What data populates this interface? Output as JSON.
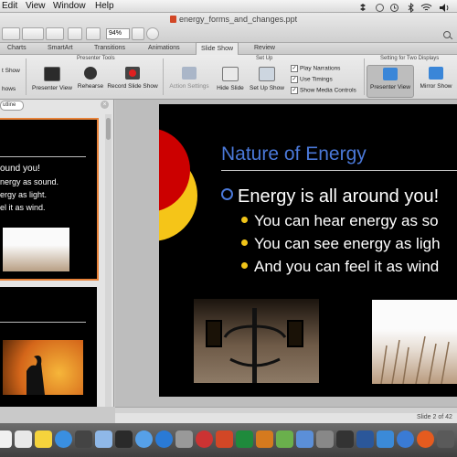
{
  "menu": {
    "items": [
      "Edit",
      "View",
      "Window",
      "Help"
    ]
  },
  "window": {
    "title": "energy_forms_and_changes.ppt",
    "zoom": "94%"
  },
  "ribbon_tabs": [
    "Charts",
    "SmartArt",
    "Transitions",
    "Animations",
    "Slide Show",
    "Review"
  ],
  "ribbon": {
    "groups": {
      "presenter_tools": "Presenter Tools",
      "set_up": "Set Up",
      "two_displays": "Setting for Two Displays"
    },
    "left_partial": [
      "t Show",
      "hows"
    ],
    "buttons": {
      "presenter_view": "Presenter View",
      "rehearse": "Rehearse",
      "record_slide_show": "Record Slide Show",
      "action_settings": "Action Settings",
      "hide_slide": "Hide Slide",
      "set_up_show": "Set Up Show",
      "presenter_view_2": "Presenter View",
      "mirror_show": "Mirror Show"
    },
    "checkboxes": {
      "play_narrations": "Play Narrations",
      "use_timings": "Use Timings",
      "show_media_controls": "Show Media Controls"
    }
  },
  "thumb_pane": {
    "outline_tab": "utline",
    "slide2_lines": [
      "ound you!",
      "nergy as sound.",
      "ergy as light.",
      "el it as wind."
    ]
  },
  "slide": {
    "title": "Nature of Energy",
    "bullet": "Energy is all around you!",
    "subs": [
      "You can hear energy as so",
      "You can see energy as ligh",
      "And you can feel it as wind"
    ]
  },
  "status": {
    "slide_count": "Slide 2 of 42"
  },
  "colors": {
    "title_blue": "#4a78d8",
    "red_arc": "#cc0000",
    "yellow_arc": "#f5c518"
  }
}
